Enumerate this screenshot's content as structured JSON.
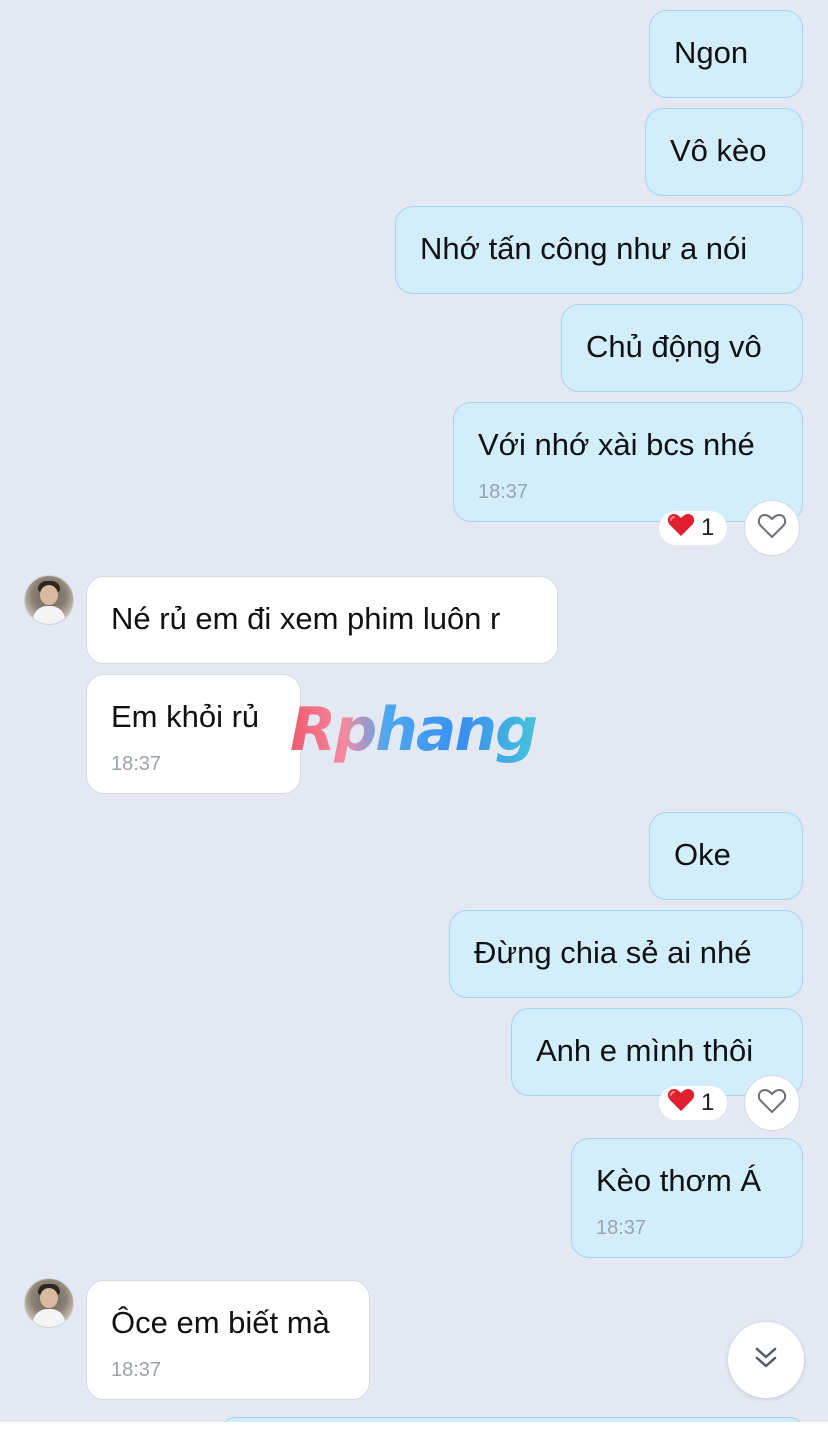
{
  "messages": [
    {
      "text": "Ngon"
    },
    {
      "text": "Vô kèo"
    },
    {
      "text": "Nhớ tấn công như a nói"
    },
    {
      "text": "Chủ động vô"
    },
    {
      "text": "Với nhớ xài bcs nhé",
      "time": "18:37",
      "reaction_count": "1"
    },
    {
      "text": "Né rủ em đi xem phim luôn r"
    },
    {
      "text": "Em khỏi rủ",
      "time": "18:37"
    },
    {
      "text": "Oke"
    },
    {
      "text": "Đừng chia sẻ ai nhé"
    },
    {
      "text": "Anh e mình thôi",
      "reaction_count": "1"
    },
    {
      "text": "Kèo thơm Á",
      "time": "18:37"
    },
    {
      "text": "Ôce em biết mà",
      "time": "18:37"
    }
  ],
  "watermark": "Rphang",
  "colors": {
    "outgoing_bubble": "#d2eefc",
    "incoming_bubble": "#ffffff",
    "background": "#e3e8f3",
    "reaction_heart": "#e0202e"
  },
  "icons": {
    "reaction": "red-heart-icon",
    "react_button": "heart-outline-icon",
    "scroll_down": "double-chevron-down-icon"
  }
}
